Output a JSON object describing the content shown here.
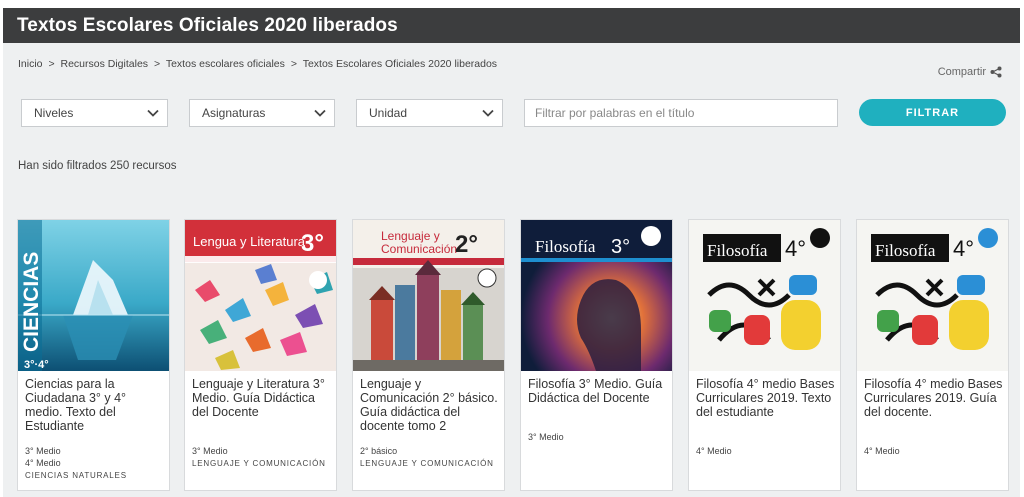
{
  "page_title": "Textos Escolares Oficiales 2020 liberados",
  "breadcrumb": [
    "Inicio",
    "Recursos Digitales",
    "Textos escolares oficiales",
    "Textos Escolares Oficiales 2020 liberados"
  ],
  "breadcrumb_sep": ">",
  "share_label": "Compartir",
  "filters": {
    "niveles": "Niveles",
    "asignaturas": "Asignaturas",
    "unidad": "Unidad",
    "search_placeholder": "Filtrar por palabras en el título",
    "button": "FILTRAR"
  },
  "result_count": "Han sido filtrados 250 recursos",
  "colors": {
    "accent": "#1fb0bf",
    "header": "#3c3d3e",
    "page_bg": "#eef0f1"
  },
  "cards": [
    {
      "title": "Ciencias para la Ciudadana 3° y 4° medio. Texto del Estudiante",
      "levels": [
        "3° Medio",
        "4° Medio"
      ],
      "subject": "CIENCIAS NATURALES",
      "cover_text": "CIENCIAS",
      "cover_grade": "3°·4°"
    },
    {
      "title": "Lenguaje y Literatura 3° Medio. Guía Didáctica del Docente",
      "levels": [
        "3° Medio"
      ],
      "subject": "LENGUAJE Y COMUNICACIÓN",
      "cover_text": "Lengua y Literatura",
      "cover_grade": "3°"
    },
    {
      "title": "Lenguaje y Comunicación 2° básico. Guía didáctica del docente tomo 2",
      "levels": [
        "2° básico"
      ],
      "subject": "LENGUAJE Y COMUNICACIÓN",
      "cover_text_1": "Lenguaje y",
      "cover_text_2": "Comunicación",
      "cover_grade": "2°"
    },
    {
      "title": "Filosofía 3° Medio. Guía Didáctica del Docente",
      "levels": [
        "3° Medio"
      ],
      "subject": "",
      "cover_text": "Filosofía",
      "cover_grade": "3°"
    },
    {
      "title": "Filosofía 4° medio Bases Curriculares 2019. Texto del estudiante",
      "levels": [
        "4° Medio"
      ],
      "subject": "",
      "cover_text": "Filosofía",
      "cover_grade": "4°"
    },
    {
      "title": "Filosofía 4° medio Bases Curriculares 2019. Guía del docente.",
      "levels": [
        "4° Medio"
      ],
      "subject": "",
      "cover_text": "Filosofía",
      "cover_grade": "4°"
    }
  ]
}
